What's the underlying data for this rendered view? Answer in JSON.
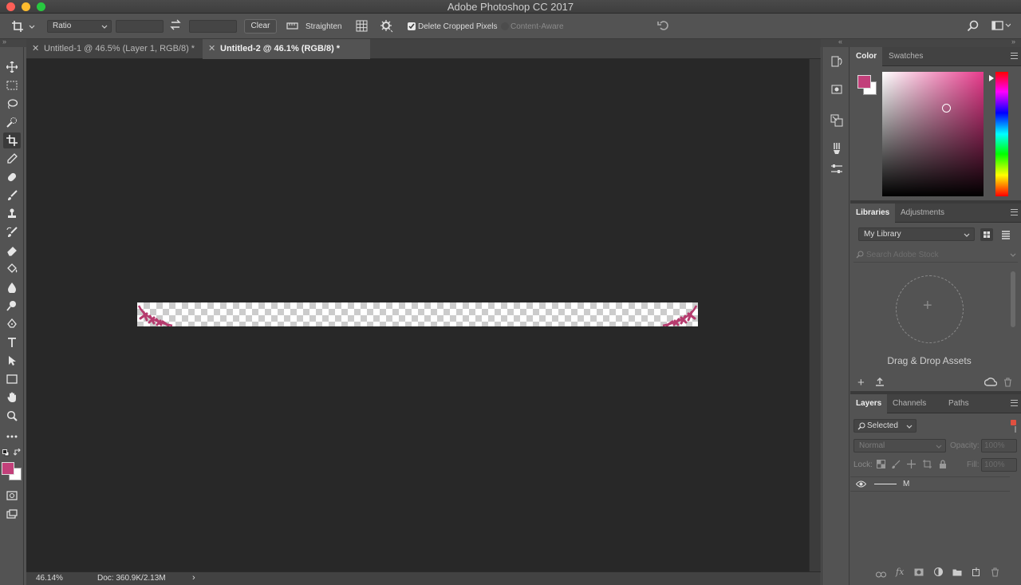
{
  "window": {
    "title": "Adobe Photoshop CC 2017"
  },
  "options_bar": {
    "ratio_select": "Ratio",
    "clear_label": "Clear",
    "straighten_label": "Straighten",
    "delete_cropped_label": "Delete Cropped Pixels",
    "delete_cropped_checked": true,
    "content_aware_label": "Content-Aware"
  },
  "tabs": [
    {
      "label": "Untitled-1 @ 46.5% (Layer 1, RGB/8) *",
      "active": false
    },
    {
      "label": "Untitled-2 @ 46.1% (RGB/8) *",
      "active": true
    }
  ],
  "status": {
    "zoom": "46.14%",
    "doc": "Doc: 360.9K/2.13M"
  },
  "colors": {
    "foreground": "#c2407a",
    "background": "#ffffff",
    "hue_field": "#e83b8c",
    "accent_stroke": "#b63b6e"
  },
  "color_panel": {
    "tabs": [
      "Color",
      "Swatches"
    ]
  },
  "libraries_panel": {
    "tabs": [
      "Libraries",
      "Adjustments"
    ],
    "library_select": "My Library",
    "search_placeholder": "Search Adobe Stock",
    "drop_text": "Drag & Drop Assets"
  },
  "layers_panel": {
    "tabs": [
      "Layers",
      "Channels",
      "Paths"
    ],
    "filter_select": "Selected",
    "blend_mode": "Normal",
    "opacity_label": "Opacity:",
    "opacity_value": "100%",
    "lock_label": "Lock:",
    "fill_label": "Fill:",
    "fill_value": "100%",
    "layers": [
      {
        "name": "M",
        "visible": true
      }
    ]
  }
}
